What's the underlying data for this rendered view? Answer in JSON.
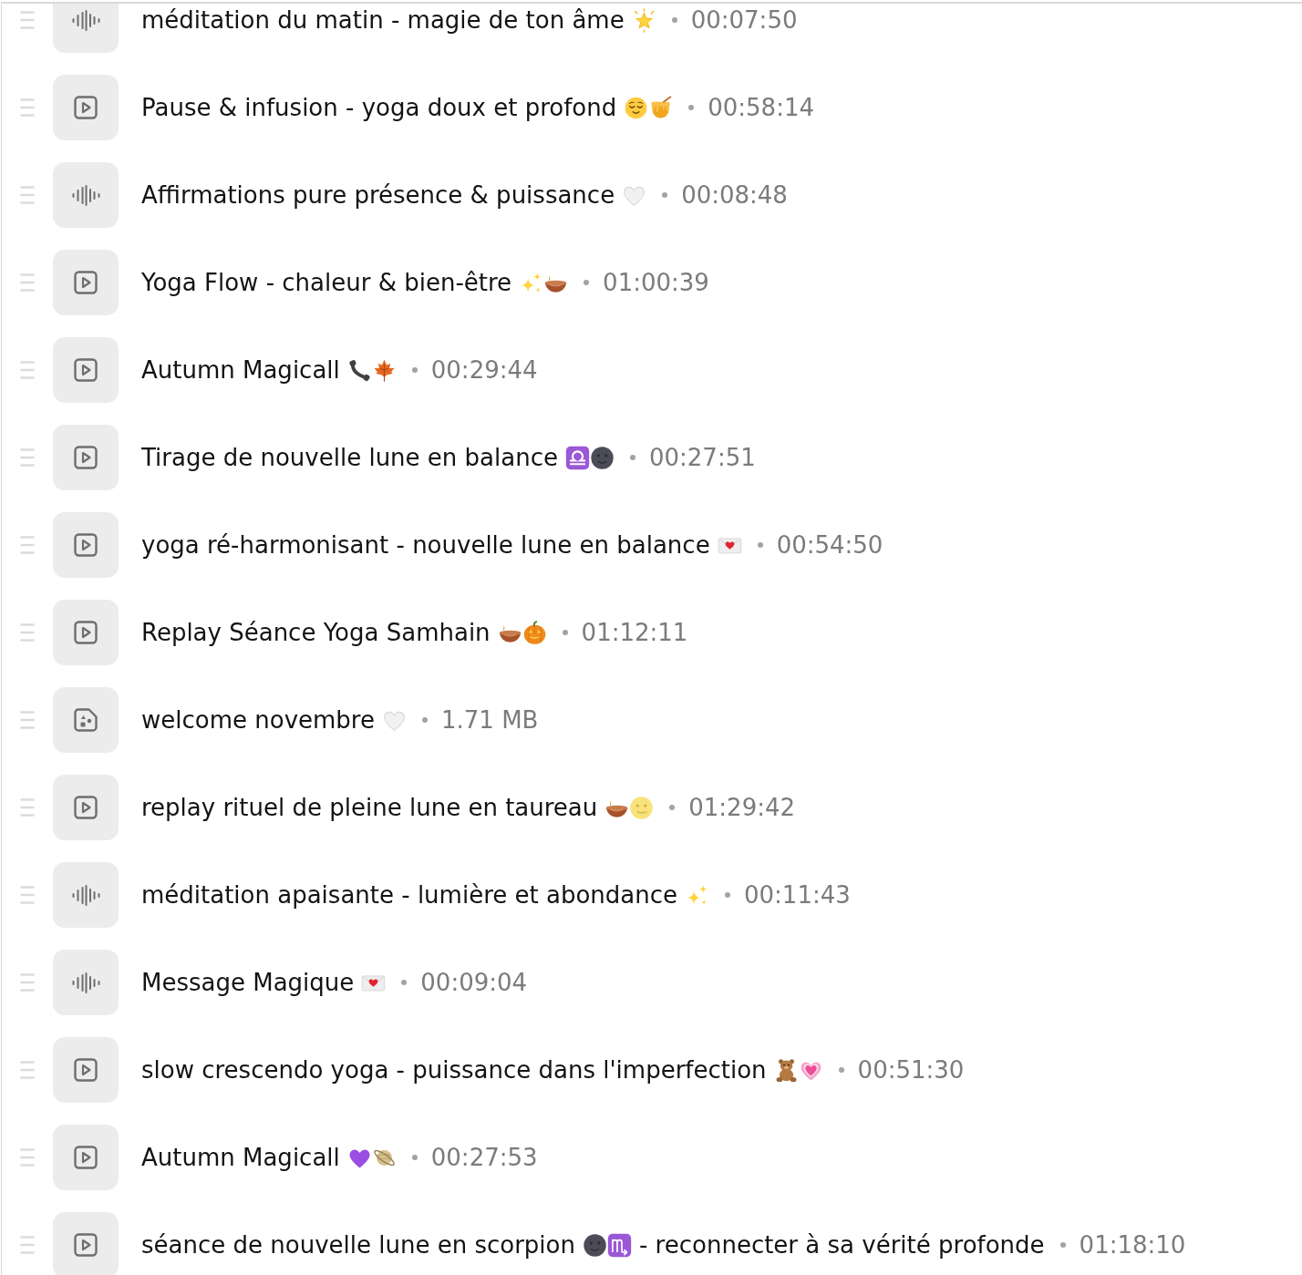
{
  "items": [
    {
      "kind": "audio",
      "title": "méditation du matin - magie de ton âme",
      "emoji": [
        {
          "kind": "glowing-star"
        }
      ],
      "duration": "00:07:50"
    },
    {
      "kind": "video",
      "title": "Pause & infusion - yoga doux et profond",
      "emoji": [
        {
          "kind": "relieved-face"
        },
        {
          "kind": "honey-pot"
        }
      ],
      "duration": "00:58:14"
    },
    {
      "kind": "audio",
      "title": "Affirmations pure présence & puissance",
      "emoji": [
        {
          "kind": "white-heart"
        }
      ],
      "duration": "00:08:48"
    },
    {
      "kind": "video",
      "title": "Yoga Flow - chaleur & bien-être",
      "emoji": [
        {
          "kind": "sparkles"
        },
        {
          "kind": "diya-lamp"
        }
      ],
      "duration": "01:00:39"
    },
    {
      "kind": "video",
      "title": "Autumn Magicall",
      "emoji": [
        {
          "kind": "telephone"
        },
        {
          "kind": "maple-leaf"
        }
      ],
      "duration": "00:29:44"
    },
    {
      "kind": "video",
      "title": "Tirage de nouvelle lune en balance",
      "emoji": [
        {
          "kind": "libra"
        },
        {
          "kind": "new-moon-face"
        }
      ],
      "duration": "00:27:51"
    },
    {
      "kind": "video",
      "title": "yoga ré-harmonisant - nouvelle lune en balance",
      "emoji": [
        {
          "kind": "love-letter"
        }
      ],
      "duration": "00:54:50"
    },
    {
      "kind": "video",
      "title": "Replay Séance Yoga Samhain",
      "emoji": [
        {
          "kind": "diya-lamp"
        },
        {
          "kind": "jack-o-lantern"
        }
      ],
      "duration": "01:12:11"
    },
    {
      "kind": "image",
      "title": "welcome novembre",
      "emoji": [
        {
          "kind": "white-heart"
        }
      ],
      "size": "1.71 MB"
    },
    {
      "kind": "video",
      "title": "replay rituel de pleine lune en taureau",
      "emoji": [
        {
          "kind": "diya-lamp"
        },
        {
          "kind": "full-moon-face"
        }
      ],
      "duration": "01:29:42"
    },
    {
      "kind": "audio",
      "title": "méditation apaisante - lumière et abondance",
      "emoji": [
        {
          "kind": "sparkles"
        }
      ],
      "duration": "00:11:43"
    },
    {
      "kind": "audio",
      "title": "Message Magique",
      "emoji": [
        {
          "kind": "love-letter"
        }
      ],
      "duration": "00:09:04"
    },
    {
      "kind": "video",
      "title": "slow crescendo yoga - puissance dans l'imperfection",
      "emoji": [
        {
          "kind": "teddy-bear"
        },
        {
          "kind": "growing-heart"
        }
      ],
      "duration": "00:51:30"
    },
    {
      "kind": "video",
      "title": "Autumn Magicall",
      "emoji": [
        {
          "kind": "purple-heart"
        },
        {
          "kind": "ringed-planet"
        }
      ],
      "duration": "00:27:53"
    },
    {
      "kind": "video",
      "title": "séance de nouvelle lune en scorpion",
      "emoji": [
        {
          "kind": "new-moon-face"
        },
        {
          "kind": "scorpio"
        }
      ],
      "title_end": "- reconnecter à sa vérité profonde",
      "duration": "01:18:10"
    }
  ]
}
